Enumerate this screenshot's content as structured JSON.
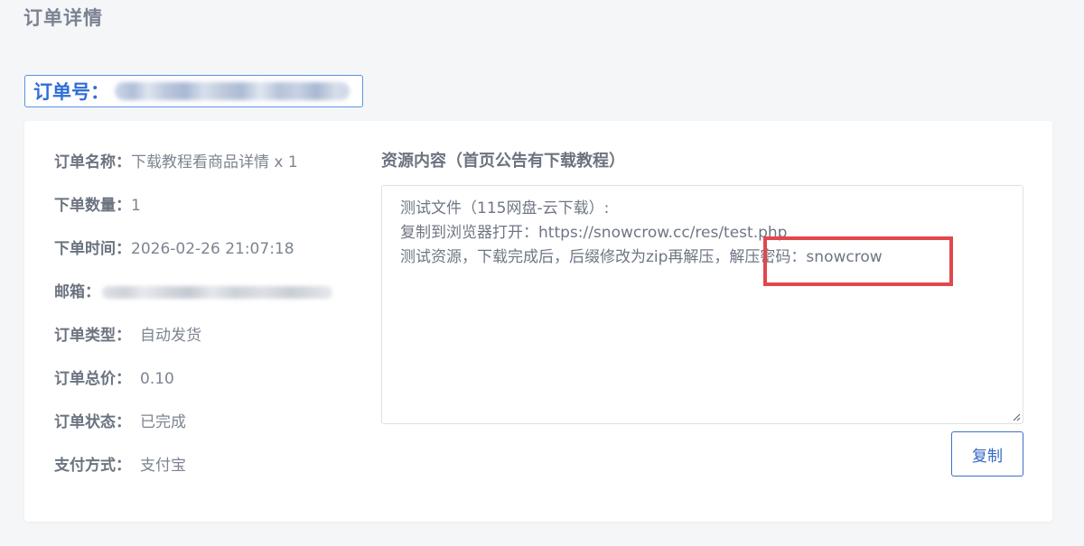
{
  "page": {
    "title": "订单详情"
  },
  "order_id": {
    "label": "订单号："
  },
  "info": [
    {
      "label": "订单名称：",
      "value": "下载教程看商品详情 x 1"
    },
    {
      "label": "下单数量：",
      "value": "1"
    },
    {
      "label": "下单时间：",
      "value": "2026-02-26 21:07:18"
    },
    {
      "label": "邮箱：",
      "value": ""
    },
    {
      "label": "订单类型：",
      "value": "自动发货"
    },
    {
      "label": "订单总价：",
      "value": "0.10"
    },
    {
      "label": "订单状态：",
      "value": "已完成"
    },
    {
      "label": "支付方式：",
      "value": "支付宝"
    }
  ],
  "resource": {
    "title": "资源内容（首页公告有下载教程）",
    "lines": [
      "测试文件（115网盘-云下载）:",
      "复制到浏览器打开：https://snowcrow.cc/res/test.php",
      "测试资源，下载完成后，后缀修改为zip再解压，解压密码：snowcrow"
    ]
  },
  "copy_button": {
    "label": "复制"
  },
  "colors": {
    "accent": "#2f6ed8",
    "highlight": "#e2474b",
    "background": "#f5f6f8"
  }
}
